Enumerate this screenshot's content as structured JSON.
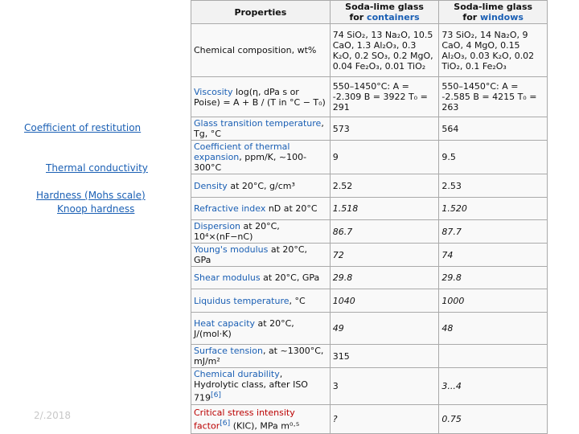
{
  "side_links": {
    "restitution": "Coefficient of restitution",
    "thermal": "Thermal conductivity",
    "hardness": "Hardness (Mohs scale)",
    "knoop": "Knoop hardness"
  },
  "date": "2/.2018",
  "table": {
    "headers": {
      "properties": "Properties",
      "containers_line1": "Soda-lime glass",
      "containers_line2_prefix": "for ",
      "containers_line2_link": "containers",
      "windows_line1": "Soda-lime glass",
      "windows_line2_prefix": "for ",
      "windows_line2_link": "windows"
    },
    "rows": {
      "composition": {
        "label": "Chemical composition, wt%",
        "containers": "74 SiO₂, 13 Na₂O, 10.5 CaO, 1.3 Al₂O₃, 0.3 K₂O, 0.2 SO₃, 0.2 MgO, 0.04 Fe₂O₃, 0.01 TiO₂",
        "windows": "73 SiO₂, 14 Na₂O, 9 CaO, 4 MgO, 0.15 Al₂O₃, 0.03 K₂O, 0.02 TiO₂, 0.1 Fe₂O₃"
      },
      "viscosity": {
        "label_link": "Viscosity",
        "label_rest": "log(η, dPa s or Poise) = A + B / (T in °C − T₀)",
        "containers": "550–1450°C: A = -2.309 B = 3922 T₀ = 291",
        "windows": "550–1450°C: A = -2.585 B = 4215 T₀ = 263"
      },
      "tg": {
        "label_link": "Glass transition temperature",
        "label_rest": ", Tg, °C",
        "containers": "573",
        "windows": "564"
      },
      "expansion": {
        "label_link": "Coefficient of thermal expansion",
        "label_rest": ", ppm/K, ~100-300°C",
        "containers": "9",
        "windows": "9.5"
      },
      "density": {
        "label_link": "Density",
        "label_rest": " at 20°C, g/cm³",
        "containers": "2.52",
        "windows": "2.53"
      },
      "refractive": {
        "label_link": "Refractive index",
        "label_rest": " nD at 20°C",
        "containers": "1.518",
        "windows": "1.520"
      },
      "dispersion": {
        "label_link": "Dispersion",
        "label_rest": " at 20°C, 10⁴×(nF−nC)",
        "containers": "86.7",
        "windows": "87.7"
      },
      "youngs": {
        "label_link": "Young's modulus",
        "label_rest": " at 20°C, GPa",
        "containers": "72",
        "windows": "74"
      },
      "shear": {
        "label_link": "Shear modulus",
        "label_rest": " at 20°C, GPa",
        "containers": "29.8",
        "windows": "29.8"
      },
      "liquidus": {
        "label_link": "Liquidus temperature",
        "label_rest": ", °C",
        "containers": "1040",
        "windows": "1000"
      },
      "heat": {
        "label_link": "Heat capacity",
        "label_rest": " at 20°C, J/(mol·K)",
        "containers": "49",
        "windows": "48"
      },
      "surface": {
        "label_link": "Surface tension",
        "label_rest": ", at ~1300°C, mJ/m²",
        "containers": "315",
        "windows": ""
      },
      "durability": {
        "label_link": "Chemical durability",
        "label_rest": ", Hydrolytic class, after ISO 719",
        "label_ref": "[6]",
        "containers": "3",
        "windows": "3...4"
      },
      "fracture": {
        "label_link": "Critical stress intensity factor",
        "label_ref": "[6]",
        "label_rest": " (KIC), MPa m⁰·⁵",
        "containers": "?",
        "windows": "0.75"
      }
    }
  }
}
